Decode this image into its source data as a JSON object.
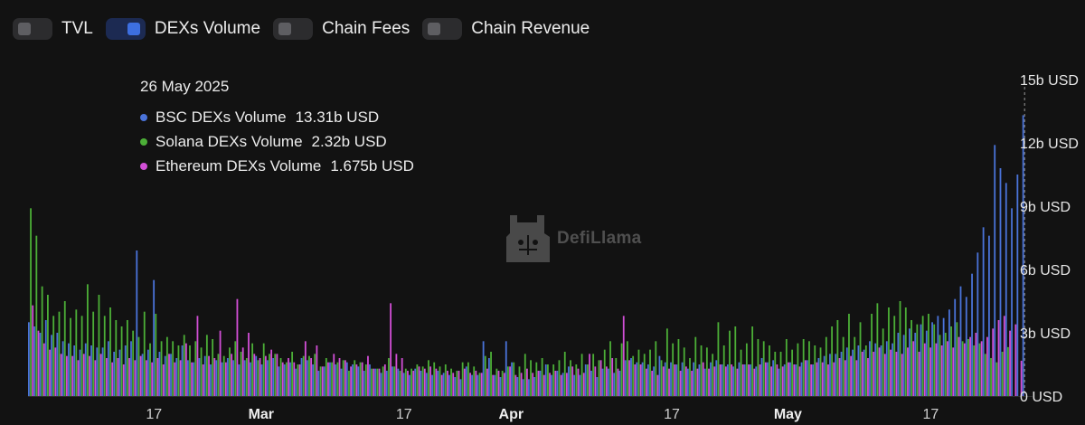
{
  "toggles": [
    {
      "label": "TVL",
      "active": false
    },
    {
      "label": "DEXs Volume",
      "active": true
    },
    {
      "label": "Chain Fees",
      "active": false
    },
    {
      "label": "Chain Revenue",
      "active": false
    }
  ],
  "tooltip": {
    "date": "26 May 2025",
    "rows": [
      {
        "name": "BSC DEXs Volume",
        "value": "13.31b USD",
        "color": "#4a73d9"
      },
      {
        "name": "Solana DEXs Volume",
        "value": "2.32b USD",
        "color": "#4caf37"
      },
      {
        "name": "Ethereum DEXs Volume",
        "value": "1.675b USD",
        "color": "#d24fd6"
      }
    ]
  },
  "watermark": "DefiLlama",
  "chart_data": {
    "type": "bar",
    "grouped": true,
    "x_start": "2025-02-03",
    "x_end": "2025-05-26",
    "x_ticks": [
      "17",
      "Mar",
      "17",
      "Apr",
      "17",
      "May",
      "17"
    ],
    "y_ticks": [
      "0 USD",
      "3b USD",
      "6b USD",
      "9b USD",
      "12b USD",
      "15b USD"
    ],
    "ylim": [
      0,
      15
    ],
    "y_unit": "b USD",
    "grid": false,
    "legend": "tooltip top-left",
    "series": [
      {
        "name": "BSC DEXs Volume",
        "color": "#4a73d9",
        "values": [
          3.5,
          3.3,
          3.0,
          3.6,
          2.9,
          3.0,
          2.6,
          2.5,
          2.4,
          2.2,
          2.5,
          2.4,
          2.3,
          2.3,
          2.6,
          2.1,
          2.2,
          2.4,
          2.6,
          6.9,
          2.0,
          2.2,
          5.5,
          2.1,
          1.9,
          2.0,
          1.8,
          2.4,
          1.7,
          1.6,
          1.8,
          1.9,
          1.5,
          1.7,
          1.6,
          1.8,
          1.7,
          1.5,
          1.7,
          1.6,
          1.9,
          1.5,
          1.7,
          1.8,
          1.4,
          1.5,
          1.6,
          1.3,
          1.8,
          1.7,
          1.5,
          1.2,
          1.4,
          1.6,
          1.5,
          1.3,
          1.6,
          1.5,
          1.4,
          1.2,
          1.5,
          1.3,
          1.1,
          1.2,
          1.4,
          1.3,
          1.1,
          1.0,
          1.3,
          1.2,
          1.1,
          1.0,
          1.2,
          1.1,
          1.0,
          0.9,
          0.8,
          1.4,
          1.0,
          1.0,
          2.6,
          1.8,
          1.0,
          0.9,
          2.6,
          1.6,
          0.9,
          0.8,
          0.8,
          0.9,
          1.2,
          1.5,
          1.0,
          1.2,
          1.1,
          1.4,
          1.0,
          1.0,
          1.5,
          1.2,
          0.9,
          1.3,
          1.3,
          1.1,
          1.2,
          1.7,
          1.8,
          1.6,
          1.6,
          1.5,
          1.4,
          1.9,
          1.6,
          1.6,
          1.5,
          1.6,
          1.3,
          1.6,
          1.5,
          1.3,
          1.6,
          1.7,
          1.5,
          1.5,
          1.4,
          1.6,
          1.5,
          1.5,
          1.4,
          1.8,
          1.6,
          1.7,
          1.3,
          1.5,
          1.6,
          1.5,
          1.6,
          1.7,
          1.5,
          1.8,
          1.9,
          2.0,
          2.0,
          2.1,
          2.3,
          2.2,
          2.4,
          2.2,
          2.6,
          2.5,
          2.4,
          2.6,
          2.5,
          3.0,
          2.9,
          3.2,
          3.0,
          3.4,
          3.1,
          3.5,
          3.8,
          3.7,
          4.1,
          4.6,
          5.2,
          4.7,
          5.8,
          6.8,
          8.0,
          7.6,
          11.9,
          10.8,
          10.1,
          8.9,
          10.5,
          13.31
        ]
      },
      {
        "name": "Solana DEXs Volume",
        "color": "#4caf37",
        "values": [
          8.9,
          7.6,
          5.2,
          4.8,
          3.8,
          4.0,
          4.5,
          3.7,
          4.1,
          3.8,
          5.3,
          4.0,
          4.8,
          3.8,
          4.2,
          3.6,
          3.3,
          3.6,
          3.1,
          2.8,
          4.0,
          2.5,
          3.9,
          2.6,
          2.8,
          2.6,
          2.4,
          2.9,
          2.4,
          2.6,
          2.3,
          2.9,
          2.7,
          2.0,
          1.9,
          2.3,
          2.6,
          2.1,
          1.8,
          2.5,
          1.7,
          2.5,
          2.0,
          2.0,
          1.8,
          1.6,
          2.1,
          1.5,
          1.9,
          1.9,
          2.0,
          1.4,
          1.8,
          1.6,
          1.6,
          1.7,
          1.2,
          1.7,
          1.6,
          1.5,
          1.3,
          1.3,
          1.4,
          1.8,
          1.4,
          1.2,
          1.3,
          1.3,
          1.5,
          1.4,
          1.7,
          1.6,
          1.4,
          1.5,
          1.3,
          1.2,
          1.6,
          1.6,
          1.4,
          1.1,
          1.9,
          2.1,
          1.3,
          1.2,
          1.4,
          1.6,
          1.4,
          2.0,
          1.7,
          1.6,
          1.8,
          1.5,
          1.5,
          1.7,
          2.1,
          1.7,
          1.5,
          2.0,
          1.5,
          2.0,
          1.7,
          2.2,
          2.6,
          1.8,
          2.5,
          2.6,
          1.9,
          2.2,
          2.0,
          2.2,
          2.6,
          1.7,
          3.2,
          2.5,
          2.7,
          2.3,
          1.8,
          2.8,
          2.4,
          2.3,
          2.0,
          3.5,
          2.4,
          3.1,
          3.3,
          2.2,
          2.5,
          3.3,
          2.7,
          2.6,
          2.4,
          2.1,
          2.1,
          2.7,
          2.2,
          2.5,
          2.7,
          2.6,
          2.4,
          2.3,
          2.8,
          3.3,
          3.6,
          2.8,
          3.9,
          2.8,
          3.5,
          2.4,
          3.9,
          4.4,
          3.2,
          4.2,
          3.8,
          4.5,
          4.2,
          3.6,
          3.4,
          3.8,
          3.9,
          3.4,
          2.9,
          3.0,
          3.3,
          3.5,
          2.6,
          2.7,
          2.4,
          2.5,
          2.0,
          1.8,
          1.6,
          2.1,
          2.32
        ]
      },
      {
        "name": "Ethereum DEXs Volume",
        "color": "#d24fd6",
        "values": [
          4.3,
          3.1,
          2.5,
          2.2,
          2.3,
          2.0,
          1.9,
          1.9,
          1.7,
          2.0,
          1.9,
          1.7,
          2.0,
          1.8,
          1.6,
          1.8,
          1.5,
          1.8,
          1.7,
          1.9,
          1.7,
          1.6,
          1.8,
          1.5,
          2.0,
          1.6,
          1.7,
          2.5,
          1.6,
          3.8,
          1.5,
          1.9,
          1.8,
          3.1,
          1.6,
          2.0,
          4.6,
          2.3,
          3.0,
          2.0,
          1.8,
          1.9,
          2.2,
          2.0,
          1.6,
          1.8,
          1.6,
          1.5,
          2.6,
          1.8,
          2.4,
          1.4,
          1.6,
          2.0,
          1.8,
          1.7,
          1.4,
          1.5,
          1.6,
          1.9,
          1.3,
          1.3,
          1.5,
          4.4,
          2.0,
          1.8,
          1.2,
          1.2,
          1.4,
          1.3,
          1.4,
          1.3,
          1.0,
          1.2,
          1.1,
          1.2,
          1.3,
          1.1,
          1.2,
          1.1,
          1.3,
          1.0,
          1.2,
          1.1,
          1.4,
          1.0,
          1.1,
          1.3,
          1.1,
          1.2,
          1.0,
          1.1,
          1.2,
          1.0,
          1.1,
          1.4,
          1.3,
          1.1,
          2.0,
          1.4,
          1.7,
          1.4,
          1.8,
          1.3,
          3.8,
          1.7,
          1.5,
          1.5,
          1.3,
          1.2,
          1.0,
          1.4,
          1.3,
          1.5,
          1.2,
          1.4,
          1.2,
          1.3,
          1.6,
          1.3,
          1.4,
          1.5,
          1.4,
          1.5,
          1.3,
          1.5,
          1.5,
          1.3,
          1.5,
          1.6,
          1.4,
          1.5,
          1.4,
          1.6,
          1.5,
          1.4,
          1.7,
          1.5,
          1.6,
          1.6,
          1.5,
          1.6,
          1.8,
          1.7,
          1.9,
          1.7,
          2.1,
          1.8,
          2.1,
          2.3,
          2.0,
          2.2,
          2.1,
          2.0,
          2.3,
          2.6,
          2.1,
          2.5,
          2.3,
          2.5,
          2.4,
          2.6,
          2.3,
          2.8,
          2.5,
          2.8,
          3.0,
          2.6,
          2.8,
          3.2,
          3.6,
          3.8,
          3.1,
          3.4,
          1.675
        ]
      }
    ]
  }
}
